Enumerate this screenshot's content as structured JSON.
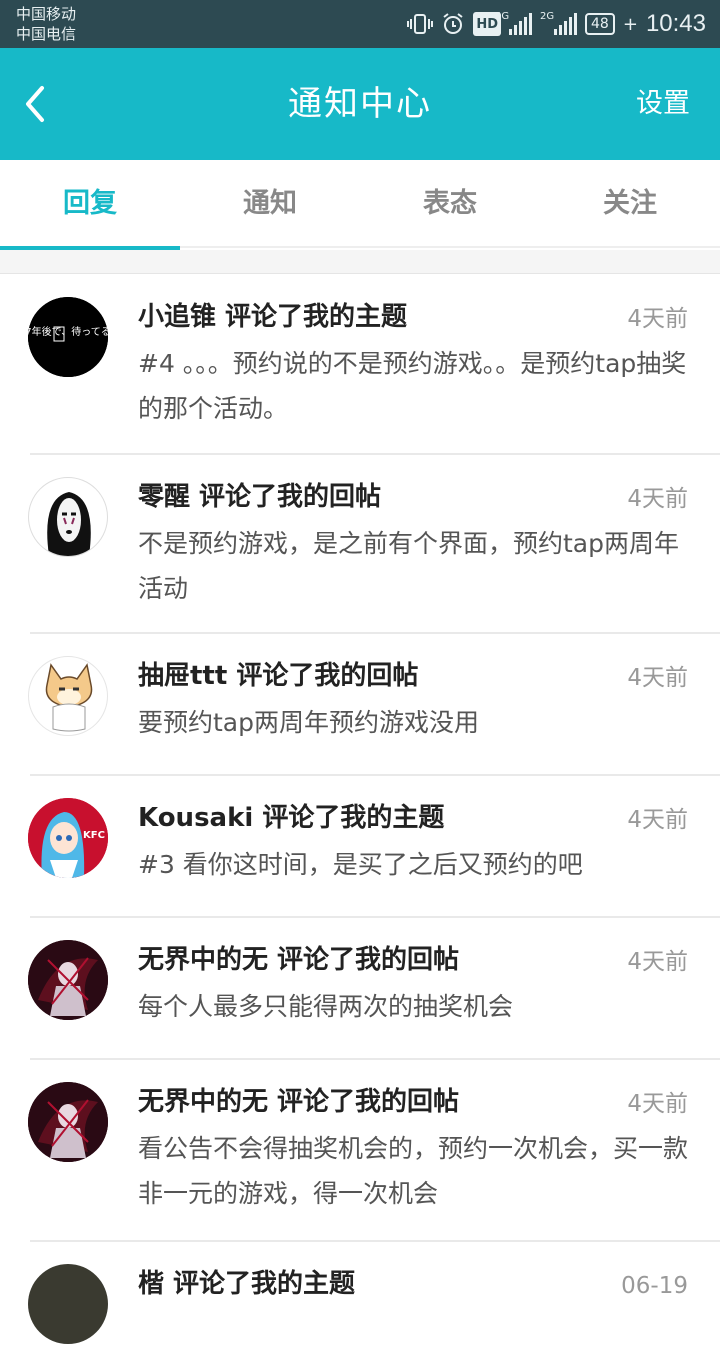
{
  "status": {
    "carrier1": "中国移动",
    "carrier2": "中国电信",
    "hd": "HD",
    "net1": "4G",
    "net2": "2G",
    "battery": "48",
    "time": "10:43"
  },
  "header": {
    "title": "通知中心",
    "settings_label": "设置"
  },
  "tabs": [
    {
      "label": "回复",
      "active": true
    },
    {
      "label": "通知",
      "active": false
    },
    {
      "label": "表态",
      "active": false
    },
    {
      "label": "关注",
      "active": false
    }
  ],
  "notifications": [
    {
      "title": "小追锥 评论了我的主题",
      "time": "4天前",
      "body": "#4 。。。预约说的不是预约游戏。。是预约tap抽奖的那个活动。",
      "avatar_text": "7年後で、待ってる"
    },
    {
      "title": "零醒 评论了我的回帖",
      "time": "4天前",
      "body": "不是预约游戏，是之前有个界面，预约tap两周年活动"
    },
    {
      "title": "抽屉ttt 评论了我的回帖",
      "time": "4天前",
      "body": "要预约tap两周年预约游戏没用"
    },
    {
      "title": "Kousaki 评论了我的主题",
      "time": "4天前",
      "body": "#3 看你这时间，是买了之后又预约的吧",
      "avatar_text": "KFC"
    },
    {
      "title": "无界中的无 评论了我的回帖",
      "time": "4天前",
      "body": "每个人最多只能得两次的抽奖机会"
    },
    {
      "title": "无界中的无 评论了我的回帖",
      "time": "4天前",
      "body": "看公告不会得抽奖机会的，预约一次机会，买一款非一元的游戏，得一次机会"
    },
    {
      "title": "楷 评论了我的主题",
      "time": "06-19",
      "body": ""
    }
  ],
  "colors": {
    "accent": "#17b9c8",
    "statusbar": "#2d4a52"
  }
}
